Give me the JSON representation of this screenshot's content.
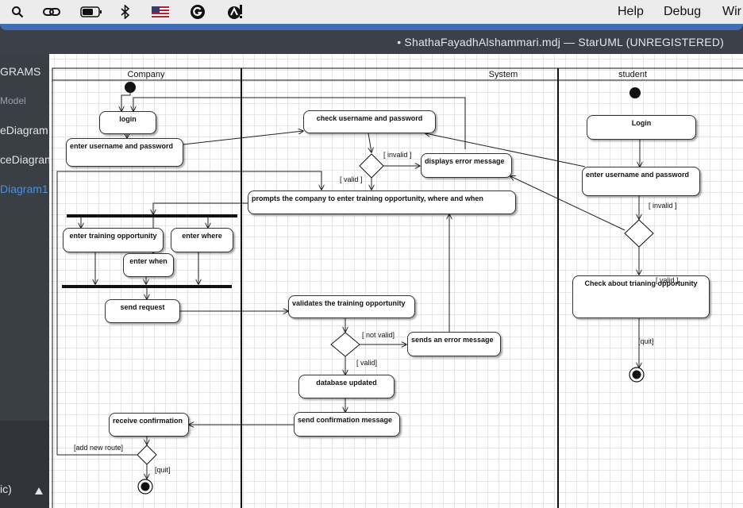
{
  "menubar": {
    "icons": [
      "search-icon",
      "link-icon",
      "battery-icon",
      "bluetooth-icon",
      "flag-icon",
      "grammarly-icon",
      "alert-icon"
    ],
    "menus": [
      "Help",
      "Debug",
      "Wir"
    ]
  },
  "window": {
    "title": "• ShathaFayadhAlshammari.mdj — StarUML (UNREGISTERED)"
  },
  "sidebar": {
    "items": [
      "GRAMS",
      "Model",
      "eDiagram",
      "ceDiagran",
      "Diagram1"
    ],
    "footer": "ic)",
    "footer_icon": "triangle-up-icon"
  },
  "diagram": {
    "lanes": [
      "Company",
      "System",
      "student"
    ],
    "actions": {
      "login": "login",
      "enter_user_pass": "enter username and password",
      "enter_training": "enter training opportunity",
      "enter_where": "enter where",
      "enter_when": "enter when",
      "send_request": "send request",
      "receive_confirmation": "receive confirmation",
      "check_user_pass": "check username and password",
      "displays_error": "displays error message",
      "prompts": "prompts the company to enter training opportunity, where and when",
      "validates": "validates the training opportunity",
      "sends_error": "sends an error message",
      "database_updated": "database updated",
      "send_confirmation": "send confirmation message",
      "student_login": "Login",
      "student_enter": "enter username and password",
      "check_training": "Check about trianing opportunity"
    },
    "guards": {
      "invalid_sys": "[ invalid ]",
      "valid_sys": "[ valid ]",
      "not_valid": "[ not valid]",
      "valid2": "[ valid]",
      "add_new_route": "[add new route]",
      "quit_company": "[quit]",
      "invalid_student": "[ invalid ]",
      "valid_student": "[ valid ]",
      "quit_student": "[quit]"
    }
  }
}
